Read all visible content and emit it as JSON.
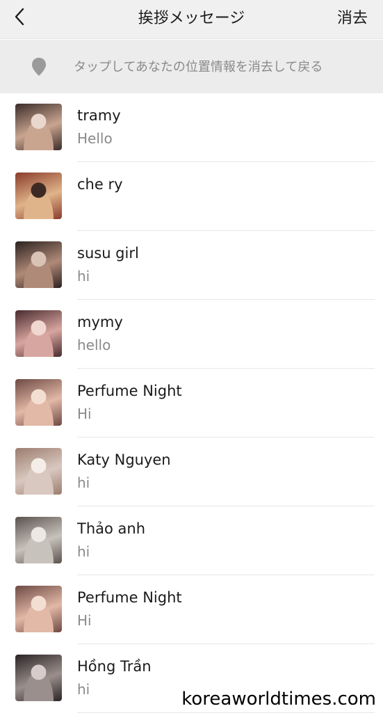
{
  "nav": {
    "title": "挨拶メッセージ",
    "clear_label": "消去"
  },
  "location": {
    "hint": "タップしてあなたの位置情報を消去して戻る"
  },
  "conversations": [
    {
      "name": "tramy",
      "message": "Hello",
      "colors": [
        "#c9a590",
        "#3b2c2a",
        "#e9d6cc"
      ]
    },
    {
      "name": "che ry",
      "message": "",
      "colors": [
        "#e0b48a",
        "#8a3c2c",
        "#3d2a24"
      ]
    },
    {
      "name": "susu girl",
      "message": "hi",
      "colors": [
        "#b08a78",
        "#2c2220",
        "#d9c3b5"
      ]
    },
    {
      "name": "mymy",
      "message": "hello",
      "colors": [
        "#d8a6a0",
        "#4a2b2e",
        "#f0d7d0"
      ]
    },
    {
      "name": "Perfume Night",
      "message": "Hi",
      "colors": [
        "#e2b8a6",
        "#6e4a44",
        "#f3dfd2"
      ]
    },
    {
      "name": "Katy Nguyen",
      "message": "hi",
      "colors": [
        "#d9c8c0",
        "#9c7d6e",
        "#f5ede8"
      ]
    },
    {
      "name": "Thảo anh",
      "message": "hi",
      "colors": [
        "#c8c2bc",
        "#5a524e",
        "#ece8e4"
      ]
    },
    {
      "name": "Perfume Night",
      "message": "Hi",
      "colors": [
        "#e2b8a6",
        "#6e4a44",
        "#f3dfd2"
      ]
    },
    {
      "name": "Hồng Trần",
      "message": "hi",
      "colors": [
        "#9a8f8c",
        "#2a2426",
        "#d6cccb"
      ]
    }
  ],
  "watermark": "koreaworldtimes.com"
}
